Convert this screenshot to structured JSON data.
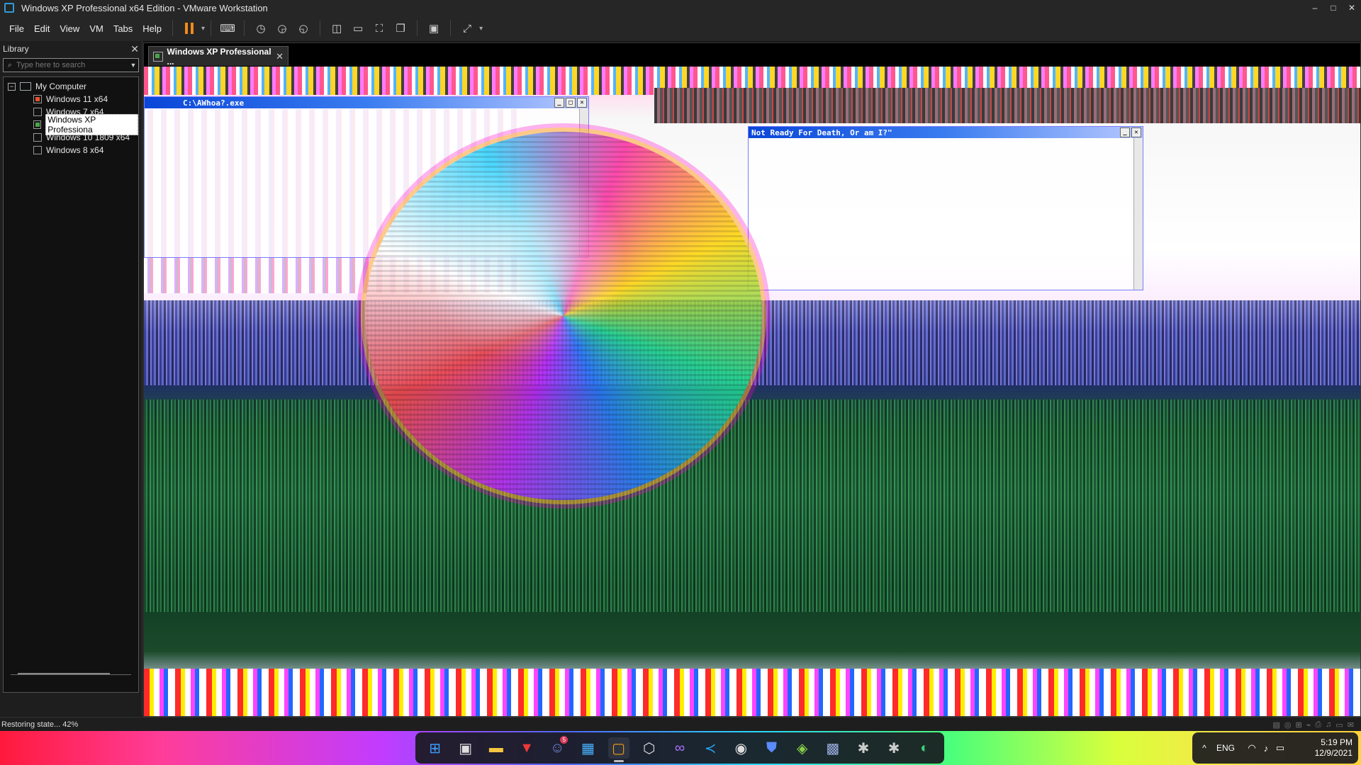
{
  "window": {
    "title": "Windows XP Professional x64 Edition - VMware Workstation",
    "controls": {
      "minimize": "–",
      "maximize": "□",
      "close": "✕"
    }
  },
  "menubar": {
    "items": [
      "File",
      "Edit",
      "View",
      "VM",
      "Tabs",
      "Help"
    ]
  },
  "toolbar": {
    "pause_caret": "▾",
    "fullscreen_caret": "▾"
  },
  "library": {
    "title": "Library",
    "close": "✕",
    "search_placeholder": "Type here to search",
    "root_label": "My Computer",
    "root_toggle": "−",
    "vms": [
      {
        "label": "Windows 11 x64"
      },
      {
        "label": "Windows 7 x64"
      },
      {
        "label": "Windows XP Professiona"
      },
      {
        "label": "Windows 10 1809 x64"
      },
      {
        "label": "Windows 8 x64"
      }
    ]
  },
  "tab": {
    "label": "Windows XP Professional ...",
    "close": "✕"
  },
  "guest": {
    "window1_title": "C:\\AWhoa?.exe",
    "window2_title": "Not Ready For Death, Or am I?\""
  },
  "status": {
    "text": "Restoring state... 42%"
  },
  "taskbar": {
    "discord_badge": "5",
    "tray": {
      "chevron": "^",
      "language": "ENG",
      "time": "5:19 PM",
      "date": "12/9/2021"
    }
  }
}
